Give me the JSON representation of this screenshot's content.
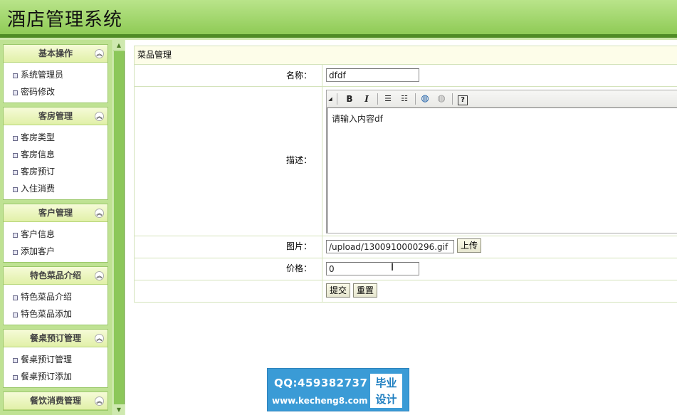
{
  "app": {
    "title": "酒店管理系统"
  },
  "sidebar": {
    "groups": [
      {
        "title": "基本操作",
        "items": [
          "系统管理员",
          "密码修改"
        ]
      },
      {
        "title": "客房管理",
        "items": [
          "客房类型",
          "客房信息",
          "客房预订",
          "入住消费"
        ]
      },
      {
        "title": "客户管理",
        "items": [
          "客户信息",
          "添加客户"
        ]
      },
      {
        "title": "特色菜品介绍",
        "items": [
          "特色菜品介绍",
          "特色菜品添加"
        ]
      },
      {
        "title": "餐桌预订管理",
        "items": [
          "餐桌预订管理",
          "餐桌预订添加"
        ]
      },
      {
        "title": "餐饮消费管理",
        "items": []
      }
    ]
  },
  "form": {
    "section_title": "菜品管理",
    "name_label": "名称：",
    "name_value": "dfdf",
    "desc_label": "描述：",
    "desc_value": "请输入内容df",
    "image_label": "图片：",
    "image_value": "/upload/1300910000296.gif",
    "upload_button": "上传",
    "price_label": "价格：",
    "price_value": "0",
    "submit_button": "提交",
    "reset_button": "重置"
  },
  "editor_toolbar": [
    "bold-icon",
    "italic-icon",
    "ordered-list-icon",
    "unordered-list-icon",
    "link-icon",
    "unlink-icon",
    "help-icon"
  ],
  "watermark": {
    "qq": "QQ:459382737",
    "url": "www.kecheng8.com",
    "badge_line1": "毕业",
    "badge_line2": "设计"
  },
  "colors": {
    "header": "#8fcb56",
    "sidebar_bg": "#bfe293",
    "accent_dark": "#4f8c25",
    "watermark": "#3a9bd6"
  }
}
